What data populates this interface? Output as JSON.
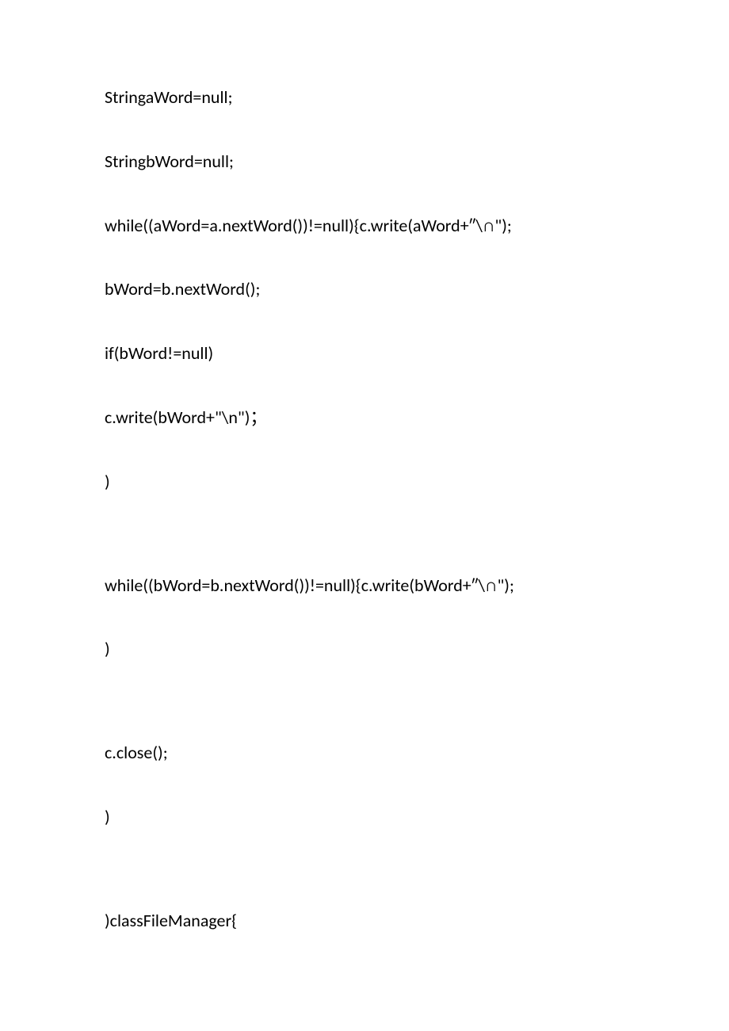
{
  "lines": [
    "StringaWord=null;",
    "StringbWord=null;",
    "while((aWord=a.nextWord())!=null){c.write(aWord+″\\∩\");",
    "bWord=b.nextWord();",
    "if(bWord!=null)",
    "c.write(bWord+\"\\n\")；",
    ")",
    "while((bWord=b.nextWord())!=null){c.write(bWord+″\\∩\");",
    ")",
    "c.close();",
    ")",
    ")classFileManager{"
  ]
}
